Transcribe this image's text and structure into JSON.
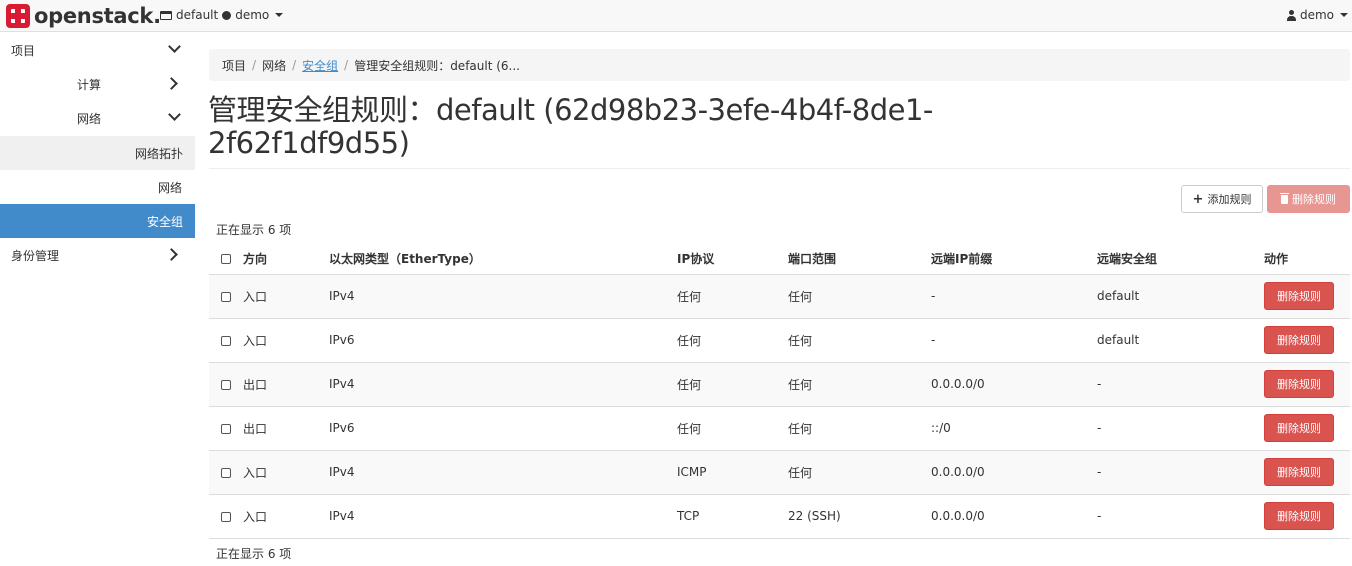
{
  "topbar": {
    "brand": "openstack.",
    "project_domain": "default",
    "project_name": "demo",
    "user": "demo"
  },
  "sidebar": {
    "items": [
      {
        "label": "项目"
      },
      {
        "label": "计算"
      },
      {
        "label": "网络"
      },
      {
        "label": "网络拓扑"
      },
      {
        "label": "网络"
      },
      {
        "label": "安全组"
      },
      {
        "label": "身份管理"
      }
    ]
  },
  "breadcrumb": {
    "items": [
      "项目",
      "网络",
      "安全组",
      "管理安全组规则：default (6..."
    ]
  },
  "page": {
    "title": "管理安全组规则：default (62d98b23-3efe-4b4f-8de1-2f62f1df9d55)",
    "add_button": "添加规则",
    "delete_button": "删除规则",
    "count_top": "正在显示 6 项",
    "count_bottom": "正在显示 6 项"
  },
  "table": {
    "headers": [
      "方向",
      "以太网类型（EtherType）",
      "IP协议",
      "端口范围",
      "远端IP前缀",
      "远端安全组",
      "动作"
    ],
    "rows": [
      {
        "direction": "入口",
        "ethertype": "IPv4",
        "protocol": "任何",
        "port_range": "任何",
        "remote_ip": "-",
        "remote_group": "default",
        "action": "删除规则"
      },
      {
        "direction": "入口",
        "ethertype": "IPv6",
        "protocol": "任何",
        "port_range": "任何",
        "remote_ip": "-",
        "remote_group": "default",
        "action": "删除规则"
      },
      {
        "direction": "出口",
        "ethertype": "IPv4",
        "protocol": "任何",
        "port_range": "任何",
        "remote_ip": "0.0.0.0/0",
        "remote_group": "-",
        "action": "删除规则"
      },
      {
        "direction": "出口",
        "ethertype": "IPv6",
        "protocol": "任何",
        "port_range": "任何",
        "remote_ip": "::/0",
        "remote_group": "-",
        "action": "删除规则"
      },
      {
        "direction": "入口",
        "ethertype": "IPv4",
        "protocol": "ICMP",
        "port_range": "任何",
        "remote_ip": "0.0.0.0/0",
        "remote_group": "-",
        "action": "删除规则"
      },
      {
        "direction": "入口",
        "ethertype": "IPv4",
        "protocol": "TCP",
        "port_range": "22 (SSH)",
        "remote_ip": "0.0.0.0/0",
        "remote_group": "-",
        "action": "删除规则"
      }
    ]
  },
  "colors": {
    "primary": "#428bca",
    "danger": "#d9534f",
    "danger_disabled": "#e79692",
    "brand_red": "#da1a32"
  }
}
